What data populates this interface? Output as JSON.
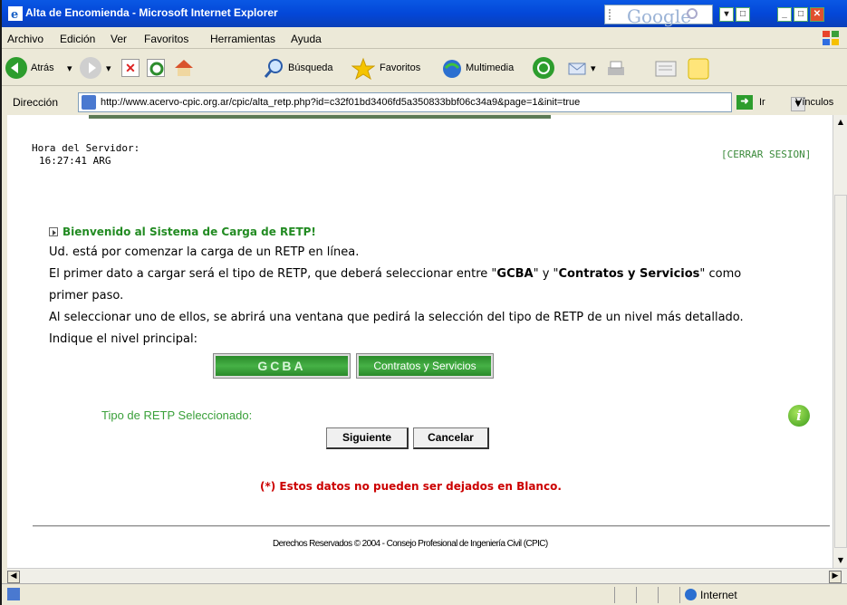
{
  "window": {
    "title": "Alta de Encomienda - Microsoft Internet Explorer",
    "google_label": "Google"
  },
  "menu": [
    "Archivo",
    "Edición",
    "Ver",
    "Favoritos",
    "Herramientas",
    "Ayuda"
  ],
  "toolbar": {
    "back": "Atrás",
    "search": "Búsqueda",
    "favorites": "Favoritos",
    "multimedia": "Multimedia"
  },
  "address": {
    "label": "Dirección",
    "url": "http://www.acervo-cpic.org.ar/cpic/alta_retp.php?id=c32f01bd3406fd5a350833bbf06c34a9&page=1&init=true",
    "go": "Ir",
    "links": "Vínculos"
  },
  "header": {
    "server_time_label": "Hora del Servidor:",
    "server_time": "16:27:41 ARG",
    "logout": "[CERRAR SESION]"
  },
  "main": {
    "welcome": "Bienvenido al Sistema de Carga de RETP!",
    "line1": "Ud. está por comenzar la carga de un RETP en línea.",
    "line2a": "El primer dato a cargar será el tipo de RETP, que deberá seleccionar entre \"",
    "line2b": "GCBA",
    "line2c": "\" y \"",
    "line2d": "Contratos y Servicios",
    "line2e": "\" como",
    "line3": "primer paso.",
    "line4": "Al seleccionar uno de ellos, se abrirá una ventana que pedirá la selección del tipo de RETP de un nivel más detallado.",
    "line5": "Indique el nivel principal:",
    "gcba_button": "GCBA",
    "contratos_button": "Contratos y Servicios",
    "selected_label": "Tipo de RETP Seleccionado:",
    "next_button": "Siguiente",
    "cancel_button": "Cancelar",
    "required_note": "(*) Estos datos no pueden ser dejados en Blanco."
  },
  "footer": "Derechos Reservados © 2004 - Consejo Profesional de Ingeniería Civil (CPIC)",
  "status": {
    "zone": "Internet"
  }
}
